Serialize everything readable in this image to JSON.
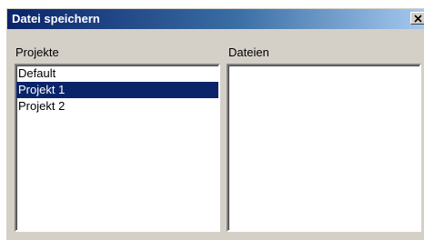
{
  "window": {
    "title": "Datei speichern",
    "close_icon": "close-icon"
  },
  "projects": {
    "label": "Projekte",
    "items": [
      {
        "label": "Default",
        "selected": false
      },
      {
        "label": "Projekt 1",
        "selected": true
      },
      {
        "label": "Projekt 2",
        "selected": false
      }
    ]
  },
  "files": {
    "label": "Dateien",
    "items": []
  },
  "colors": {
    "selection": "#0a246a",
    "title_start": "#0a246a",
    "title_end": "#a6caf0",
    "face": "#d4d0c8"
  }
}
